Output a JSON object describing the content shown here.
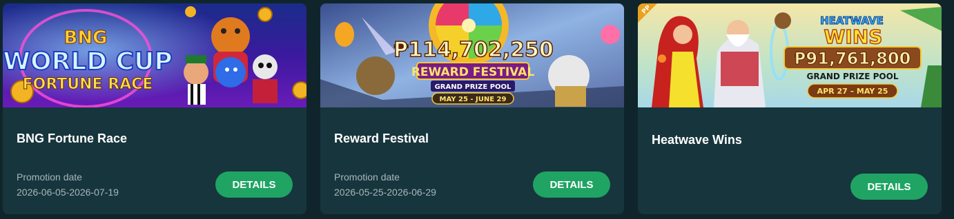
{
  "promotions": [
    {
      "title": "BNG Fortune Race",
      "date_label": "Promotion date",
      "date_range": "2026-06-05-2026-07-19",
      "button_label": "DETAILS",
      "banner": {
        "line1": "BNG",
        "line2": "WORLD CUP",
        "line3": "FORTUNE RACE"
      }
    },
    {
      "title": "Reward Festival",
      "date_label": "Promotion date",
      "date_range": "2026-05-25-2026-06-29",
      "button_label": "DETAILS",
      "banner": {
        "amount": "₱114,702,250",
        "headline": "REWARD FESTIVAL",
        "subline": "GRAND PRIZE POOL",
        "dates": "MAY 25 - JUNE 29"
      }
    },
    {
      "title": "Heatwave Wins",
      "button_label": "DETAILS",
      "banner": {
        "badge": "PP",
        "line1": "HEATWAVE",
        "line2": "WINS",
        "amount": "₱91,761,800",
        "subline": "GRAND PRIZE POOL",
        "dates": "APR 27 – MAY 25"
      }
    }
  ],
  "colors": {
    "page_bg": "#10252b",
    "card_bg": "#17353d",
    "button_bg": "#1fa463",
    "muted_text": "#a8b7bb"
  }
}
